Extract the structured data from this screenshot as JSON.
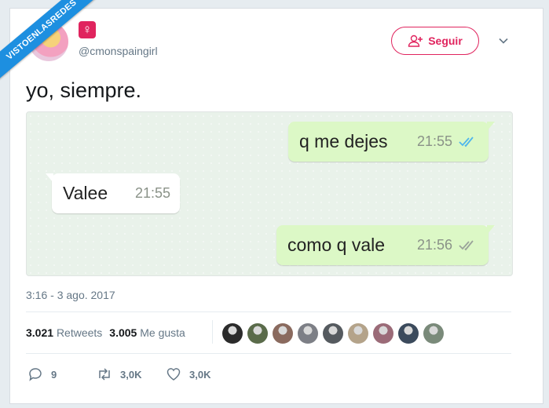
{
  "watermark": {
    "text": "VISTOENLASREDES"
  },
  "user": {
    "handle": "@cmonspaingirl",
    "badge_symbol": "♀"
  },
  "follow_button": {
    "label": "Seguir"
  },
  "tweet": {
    "text": "yo, siempre."
  },
  "chat": {
    "messages": [
      {
        "text": "q me dejes",
        "time": "21:55",
        "direction": "out",
        "read_status": "blue-double-check"
      },
      {
        "text": "Valee",
        "time": "21:55",
        "direction": "in"
      },
      {
        "text": "como q vale",
        "time": "21:56",
        "direction": "out",
        "read_status": "grey-double-check"
      }
    ]
  },
  "timestamp": "3:16 - 3 ago. 2017",
  "stats": {
    "retweets_count": "3.021",
    "retweets_label": "Retweets",
    "likes_count": "3.005",
    "likes_label": "Me gusta"
  },
  "likers": [
    "#2b2b2b",
    "#5a6b4a",
    "#8a6a5e",
    "#7d7f86",
    "#555a5f",
    "#b4a38a",
    "#9b6b78",
    "#3b4a5c",
    "#7a8a7a"
  ],
  "actions": {
    "replies": "9",
    "retweets": "3,0K",
    "likes": "3,0K"
  },
  "colors": {
    "accent": "#e0245e",
    "outgoing_bubble": "#dcf8c6",
    "read_tick": "#4fb6ec",
    "ribbon": "#1d8fe0"
  }
}
